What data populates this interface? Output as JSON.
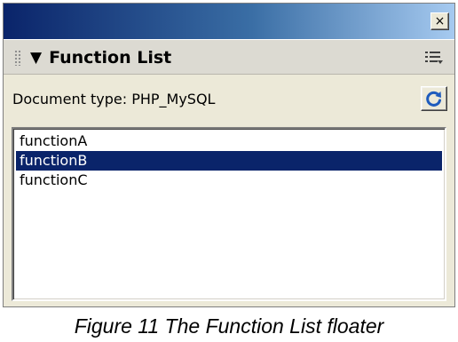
{
  "window": {
    "close_symbol": "×"
  },
  "panel": {
    "collapse_symbol": "▼",
    "title": "Function List",
    "options_icon": "panel-options-icon"
  },
  "document": {
    "label": "Document type: PHP_MySQL",
    "refresh_icon": "refresh-icon"
  },
  "function_list": {
    "items": [
      "functionA",
      "functionB",
      "functionC"
    ],
    "selected_index": 1
  },
  "caption": "Figure 11 The Function List floater",
  "colors": {
    "titlebar_dark": "#0a246a",
    "titlebar_light": "#a6caf0",
    "selection": "#0a246a",
    "refresh_icon": "#1e5bbd"
  }
}
